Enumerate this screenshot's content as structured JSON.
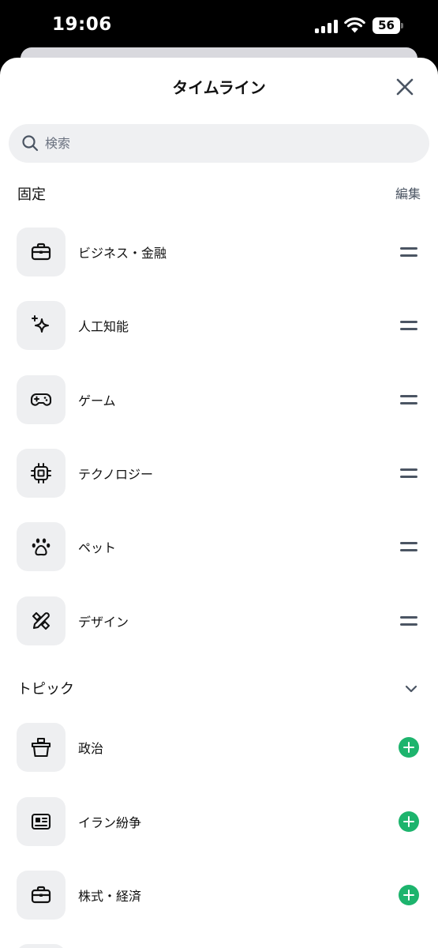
{
  "status": {
    "time": "19:06",
    "battery": "56"
  },
  "sheet": {
    "title": "タイムライン"
  },
  "search": {
    "placeholder": "検索"
  },
  "pinned": {
    "title": "固定",
    "edit_label": "編集",
    "items": [
      {
        "label": "ビジネス・金融",
        "icon": "briefcase-icon"
      },
      {
        "label": "人工知能",
        "icon": "sparkle-icon"
      },
      {
        "label": "ゲーム",
        "icon": "gamepad-icon"
      },
      {
        "label": "テクノロジー",
        "icon": "chip-icon"
      },
      {
        "label": "ペット",
        "icon": "paw-icon"
      },
      {
        "label": "デザイン",
        "icon": "pencil-ruler-icon"
      }
    ]
  },
  "topics": {
    "title": "トピック",
    "items": [
      {
        "label": "政治",
        "icon": "ballot-box-icon"
      },
      {
        "label": "イラン紛争",
        "icon": "newspaper-icon"
      },
      {
        "label": "株式・経済",
        "icon": "briefcase-icon"
      }
    ]
  },
  "colors": {
    "accent": "#1db46d",
    "icon_bg": "#eeeff1",
    "search_bg": "#eff0f2"
  }
}
